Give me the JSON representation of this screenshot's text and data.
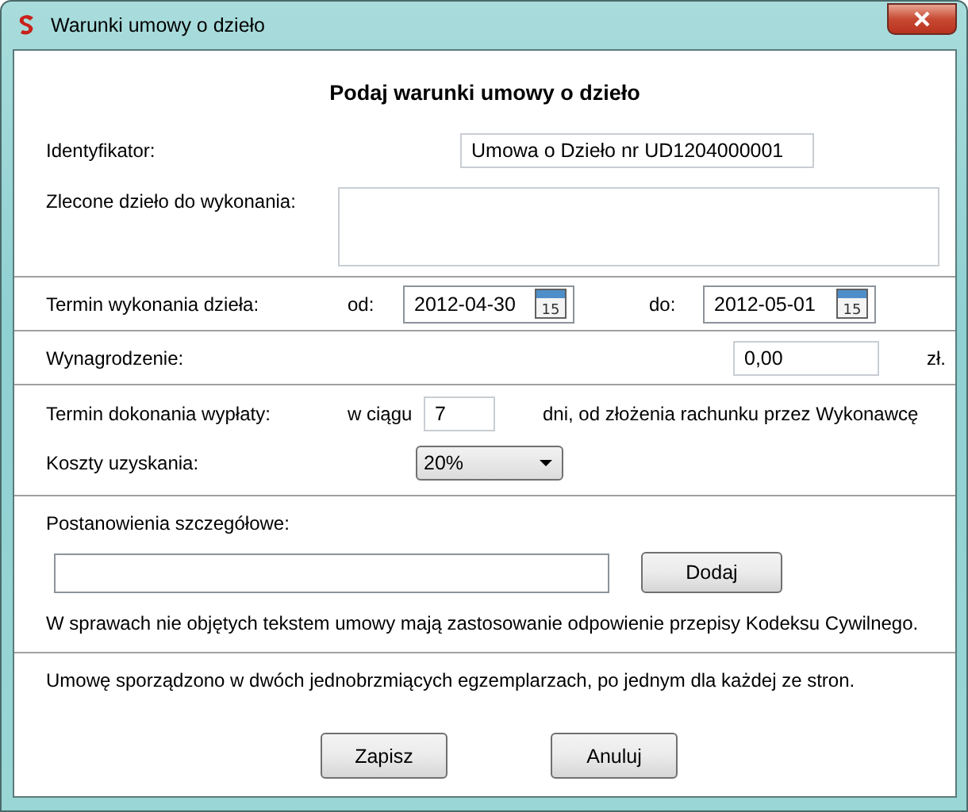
{
  "window": {
    "title": "Warunki umowy o dzieło"
  },
  "heading": "Podaj warunki umowy o dzieło",
  "identifier": {
    "label": "Identyfikator:",
    "value": "Umowa o Dzieło nr UD1204000001"
  },
  "work": {
    "label": "Zlecone dzieło do wykonania:"
  },
  "deadline": {
    "label": "Termin wykonania dzieła:",
    "from_label": "od:",
    "from": "2012-04-30",
    "to_label": "do:",
    "to": "2012-05-01",
    "from_calendar_day": "15",
    "to_calendar_day": "15"
  },
  "pay": {
    "label": "Wynagrodzenie:",
    "value": "0,00",
    "currency": "zł."
  },
  "payment_term": {
    "label": "Termin dokonania wypłaty:",
    "prefix": "w ciągu",
    "value": "7",
    "suffix": "dni, od złożenia rachunku przez Wykonawcę"
  },
  "costs": {
    "label": "Koszty uzyskania:",
    "value": "20%"
  },
  "provisions": {
    "label": "Postanowienia szczegółowe:",
    "add_button": "Dodaj",
    "note": "W sprawach nie objętych tekstem umowy mają zastosowanie odpowienie przepisy Kodeksu Cywilnego."
  },
  "closing": "Umowę sporządzono w dwóch jednobrzmiących egzemplarzach, po jednym dla każdej ze stron.",
  "buttons": [
    "Zapisz",
    "Anuluj"
  ]
}
